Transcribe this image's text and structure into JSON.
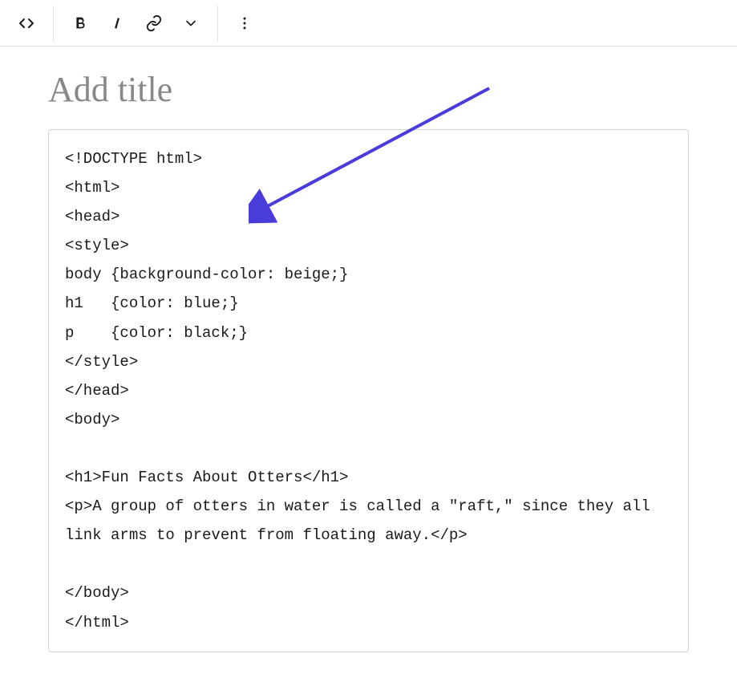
{
  "toolbar": {
    "code_icon": "code-icon",
    "bold_icon": "bold-icon",
    "italic_icon": "italic-icon",
    "link_icon": "link-icon",
    "dropdown_icon": "chevron-down-icon",
    "more_icon": "more-vertical-icon"
  },
  "editor": {
    "title_placeholder": "Add title",
    "title_value": "",
    "code_content": "<!DOCTYPE html>\n<html>\n<head>\n<style>\nbody {background-color: beige;}\nh1   {color: blue;}\np    {color: black;}\n</style>\n</head>\n<body>\n\n<h1>Fun Facts About Otters</h1>\n<p>A group of otters in water is called a \"raft,\" since they all link arms to prevent from floating away.</p>\n\n</body>\n</html>"
  },
  "annotation": {
    "arrow_color": "#4a3cdb"
  }
}
